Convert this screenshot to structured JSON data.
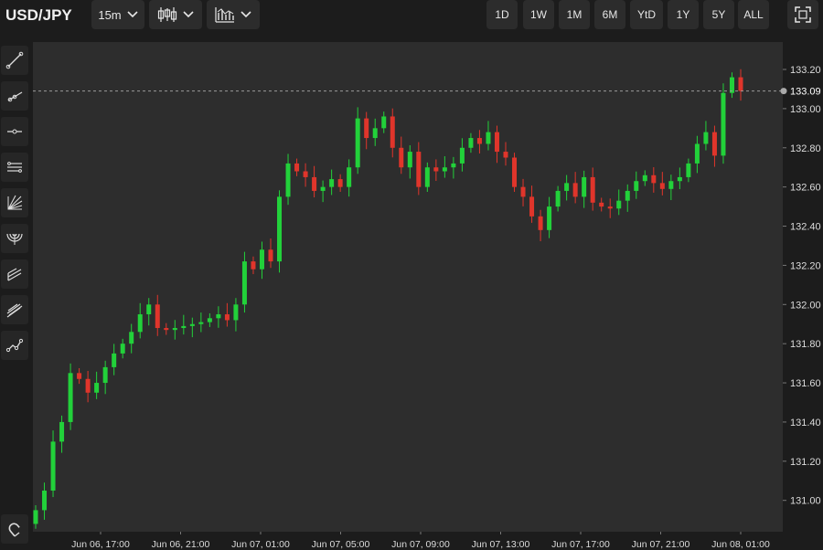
{
  "header": {
    "symbol": "USD/JPY",
    "interval": "15m",
    "ranges": [
      "1D",
      "1W",
      "1M",
      "6M",
      "YtD",
      "1Y",
      "5Y",
      "ALL"
    ]
  },
  "icons": {
    "interval_chevron": "chevron-down-icon",
    "candles": "candlestick-icon",
    "indicators": "indicators-icon",
    "fullscreen": "fullscreen-icon",
    "tools": [
      "trend-line-icon",
      "ray-icon",
      "horizontal-line-icon",
      "parallel-channel-icon",
      "fib-fan-icon",
      "fib-arc-icon",
      "pitchfork-icon",
      "regression-channel-icon",
      "path-icon"
    ],
    "magnet": "magnet-icon"
  },
  "colors": {
    "up": "#22d13a",
    "down": "#e0352b",
    "background": "#2d2d2d",
    "price_line": "#9a9a9a"
  },
  "chart_data": {
    "type": "candlestick",
    "current_price": "133.09",
    "ylim": [
      130.84,
      133.34
    ],
    "y_ticks": [
      "133.20",
      "133.00",
      "132.80",
      "132.60",
      "132.40",
      "132.20",
      "132.00",
      "131.80",
      "131.60",
      "131.40",
      "131.20",
      "131.00"
    ],
    "x_ticks": [
      "Jun 06, 17:00",
      "Jun 06, 21:00",
      "Jun 07, 01:00",
      "Jun 07, 05:00",
      "Jun 07, 09:00",
      "Jun 07, 13:00",
      "Jun 07, 17:00",
      "Jun 07, 21:00",
      "Jun 08, 01:00"
    ],
    "closes": [
      130.95,
      131.05,
      131.3,
      131.4,
      131.65,
      131.62,
      131.55,
      131.6,
      131.68,
      131.75,
      131.8,
      131.86,
      131.95,
      132.0,
      131.88,
      131.87,
      131.88,
      131.89,
      131.9,
      131.91,
      131.93,
      131.95,
      131.92,
      132.0,
      132.22,
      132.18,
      132.28,
      132.22,
      132.55,
      132.72,
      132.68,
      132.65,
      132.58,
      132.6,
      132.64,
      132.6,
      132.7,
      132.95,
      132.85,
      132.9,
      132.96,
      132.8,
      132.7,
      132.78,
      132.6,
      132.7,
      132.68,
      132.7,
      132.72,
      132.8,
      132.85,
      132.82,
      132.88,
      132.78,
      132.75,
      132.6,
      132.55,
      132.45,
      132.38,
      132.5,
      132.58,
      132.62,
      132.55,
      132.65,
      132.52,
      132.5,
      132.49,
      132.53,
      132.58,
      132.63,
      132.66,
      132.62,
      132.59,
      132.63,
      132.65,
      132.72,
      132.82,
      132.88,
      132.76,
      133.08,
      133.16,
      133.09
    ]
  }
}
